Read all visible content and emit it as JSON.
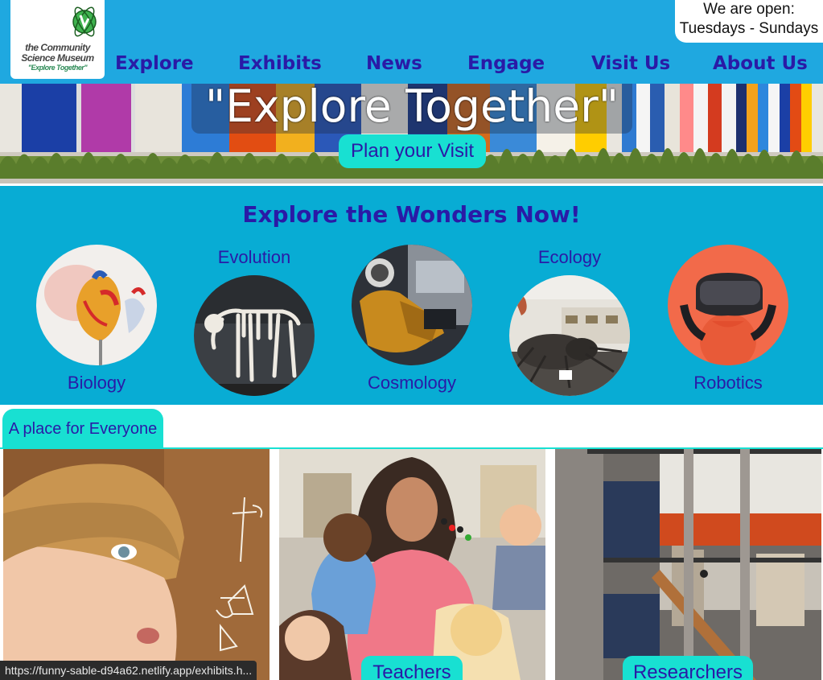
{
  "logo": {
    "line1": "the Community",
    "line2": "Science Museum",
    "line3": "\"Explore Together\""
  },
  "hours": {
    "line1": "We are open:",
    "line2": "Tuesdays - Sundays"
  },
  "nav": {
    "items": [
      "Explore",
      "Exhibits",
      "News",
      "Engage",
      "Visit Us",
      "About Us"
    ]
  },
  "hero": {
    "title": "\"Explore Together\"",
    "cta": "Plan your Visit"
  },
  "explore": {
    "title": "Explore the Wonders Now!",
    "topics": [
      "Biology",
      "Evolution",
      "Cosmology",
      "Ecology",
      "Robotics"
    ]
  },
  "everyone": {
    "tab": "A place for Everyone",
    "cards": [
      "Teachers",
      "Researchers"
    ]
  },
  "status": {
    "url": "https://funny-sable-d94a62.netlify.app/exhibits.h..."
  },
  "colors": {
    "header_bg": "#1fa8e0",
    "band_bg": "#08acd4",
    "accent": "#18e0d2",
    "text_primary": "#2a1aa6"
  },
  "icons": [
    "atom-logo-icon"
  ]
}
